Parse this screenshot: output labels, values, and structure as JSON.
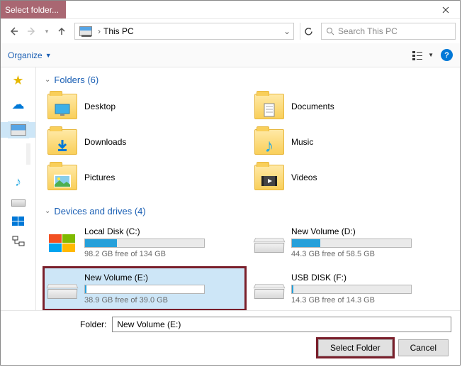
{
  "title": "Select folder...",
  "breadcrumb": {
    "location": "This PC"
  },
  "search": {
    "placeholder": "Search This PC"
  },
  "toolbar": {
    "organize": "Organize"
  },
  "sections": {
    "folders_header": "Folders (6)",
    "drives_header": "Devices and drives (4)"
  },
  "folders": [
    {
      "label": "Desktop",
      "icon": "desktop"
    },
    {
      "label": "Documents",
      "icon": "documents"
    },
    {
      "label": "Downloads",
      "icon": "downloads"
    },
    {
      "label": "Music",
      "icon": "music"
    },
    {
      "label": "Pictures",
      "icon": "pictures"
    },
    {
      "label": "Videos",
      "icon": "videos"
    }
  ],
  "drives": [
    {
      "label": "Local Disk (C:)",
      "free_text": "98.2 GB free of 134 GB",
      "used_pct": 27,
      "os": true
    },
    {
      "label": "New Volume (D:)",
      "free_text": "44.3 GB free of 58.5 GB",
      "used_pct": 24
    },
    {
      "label": "New Volume (E:)",
      "free_text": "38.9 GB free of 39.0 GB",
      "used_pct": 1,
      "selected": true
    },
    {
      "label": "USB DISK (F:)",
      "free_text": "14.3 GB free of 14.3 GB",
      "used_pct": 1
    }
  ],
  "footer": {
    "folder_label": "Folder:",
    "folder_value": "New Volume (E:)",
    "select_btn": "Select Folder",
    "cancel_btn": "Cancel"
  }
}
